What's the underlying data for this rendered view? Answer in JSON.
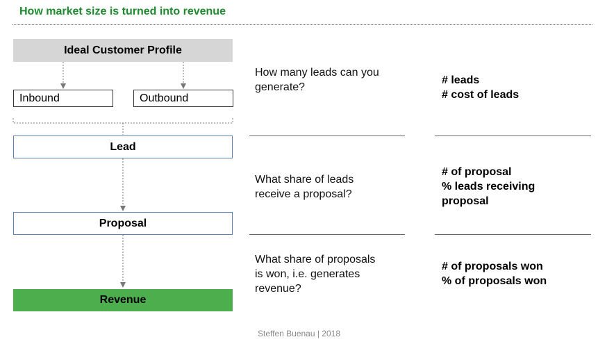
{
  "header": {
    "title": "How market size is turned into revenue"
  },
  "flow": {
    "icp": "Ideal Customer Profile",
    "inbound": "Inbound",
    "outbound": "Outbound",
    "lead": "Lead",
    "proposal": "Proposal",
    "revenue": "Revenue"
  },
  "rows": [
    {
      "question": [
        "How many leads can you",
        "generate?"
      ],
      "metrics": [
        "# leads",
        "# cost of leads"
      ]
    },
    {
      "question": [
        "What share of leads",
        "receive a proposal?"
      ],
      "metrics": [
        "# of proposal",
        "% leads receiving",
        "proposal"
      ]
    },
    {
      "question": [
        "What share of proposals",
        "is won, i.e. generates",
        "revenue?"
      ],
      "metrics": [
        "# of proposals won",
        "% of proposals won"
      ]
    }
  ],
  "footer": "Steffen Buenau | 2018",
  "colors": {
    "title": "#1e8a2e",
    "revenue_fill": "#4cae4c",
    "icp_fill": "#d6d6d6",
    "stage_border": "#5b7fb8"
  }
}
